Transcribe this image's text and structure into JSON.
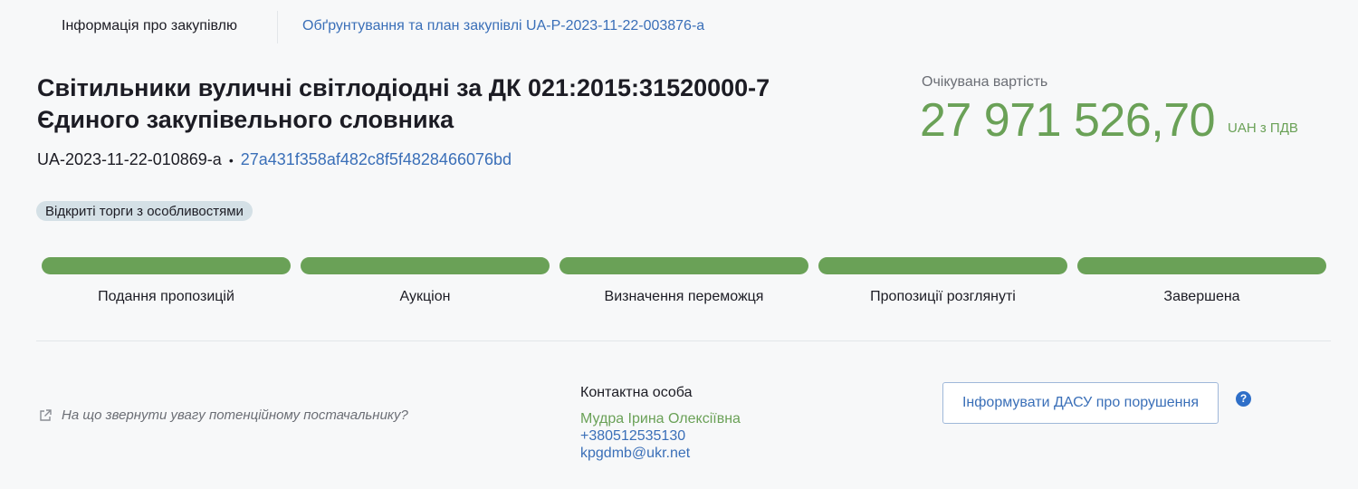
{
  "tabs": {
    "info_label": "Інформація про закупівлю",
    "plan_label": "Обґрунтування та план закупівлі UA-P-2023-11-22-003876-a"
  },
  "tender": {
    "title": "Світильники вуличні світлодіодні за ДК 021:2015:31520000-7 Єдиного закупівельного словника",
    "tender_id": "UA-2023-11-22-010869-a",
    "separator": "•",
    "hash": "27a431f358af482c8f5f4828466076bd",
    "procedure_type": "Відкриті торги з особливостями"
  },
  "price": {
    "label": "Очікувана вартість",
    "value": "27 971 526,70",
    "currency": "UAH з ПДВ"
  },
  "stages": [
    {
      "label": "Подання пропозицій",
      "status": "completed"
    },
    {
      "label": "Аукціон",
      "status": "completed"
    },
    {
      "label": "Визначення переможця",
      "status": "completed"
    },
    {
      "label": "Пропозиції розглянуті",
      "status": "completed"
    },
    {
      "label": "Завершена",
      "status": "completed"
    }
  ],
  "hint": {
    "text": "На що звернути увагу потенційному постачальнику?",
    "icon": "external-link-icon"
  },
  "contact": {
    "title": "Контактна особа",
    "name": "Мудра Ірина Олексіївна",
    "phone": "+380512535130",
    "email": "kpgdmb@ukr.net"
  },
  "dasu": {
    "button_label": "Інформувати ДАСУ про порушення",
    "help_symbol": "?"
  },
  "colors": {
    "accent_green": "#6aa157",
    "link_blue": "#3a6fb8",
    "badge_bg": "#d4e0e6"
  }
}
